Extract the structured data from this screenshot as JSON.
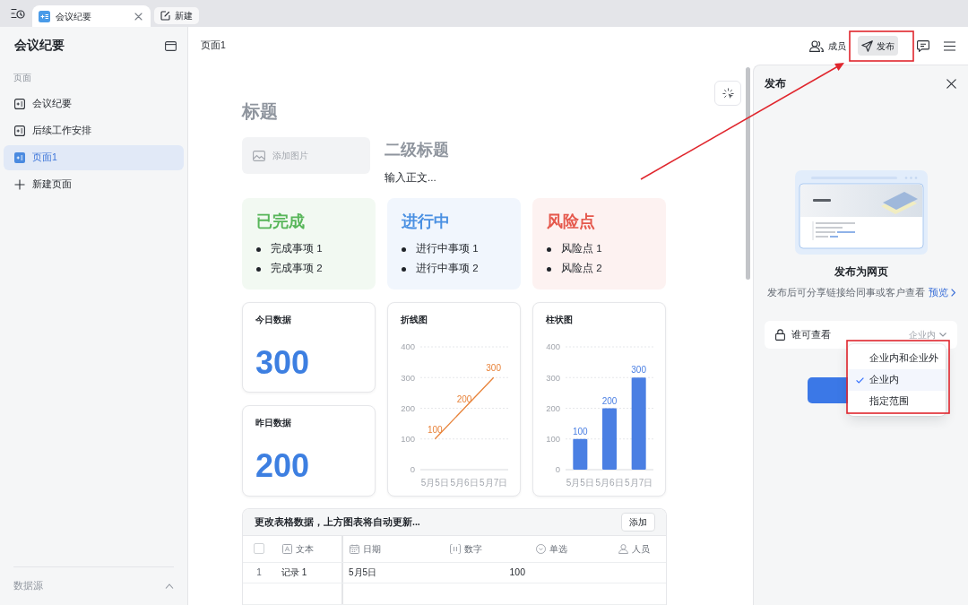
{
  "tab_bar": {
    "tabs": [
      {
        "label": "会议纪要",
        "selected": true
      }
    ],
    "new_button": "新建"
  },
  "sidebar": {
    "title": "会议纪要",
    "section_label": "页面",
    "pages": [
      {
        "label": "会议纪要",
        "selected": false
      },
      {
        "label": "后续工作安排",
        "selected": false
      },
      {
        "label": "页面1",
        "selected": true
      }
    ],
    "new_page": "新建页面",
    "footer": "数据源"
  },
  "header": {
    "page_title": "页面1",
    "members_button": "成员",
    "publish_button": {
      "label": "发布",
      "active": true
    }
  },
  "document": {
    "title": "标题",
    "image_placeholder": "添加图片",
    "subtitle": "二级标题",
    "body": "输入正文...",
    "status_cards": [
      {
        "title": "已完成",
        "color": "#58b65a",
        "items": [
          "完成事项 1",
          "完成事项 2"
        ]
      },
      {
        "title": "进行中",
        "color": "#4a90e2",
        "items": [
          "进行中事项 1",
          "进行中事项 2"
        ]
      },
      {
        "title": "风险点",
        "color": "#e5584c",
        "items": [
          "风险点 1",
          "风险点 2"
        ]
      }
    ],
    "metrics": [
      {
        "label": "今日数据",
        "value": "300"
      },
      {
        "label": "昨日数据",
        "value": "200"
      }
    ],
    "charts": [
      {
        "chart_data": {
          "type": "line",
          "title": "折线图",
          "categories": [
            "5月5日",
            "5月6日",
            "5月7日"
          ],
          "series": [
            {
              "color": "#e8833a",
              "values": [
                100,
                200,
                300
              ]
            }
          ],
          "ylim": [
            0,
            400
          ],
          "yticks": [
            0,
            100,
            200,
            300,
            400
          ],
          "grid": true,
          "data_labels": true
        }
      },
      {
        "chart_data": {
          "type": "bar",
          "title": "柱状图",
          "categories": [
            "5月5日",
            "5月6日",
            "5月7日"
          ],
          "series": [
            {
              "color": "#4a7fe3",
              "values": [
                100,
                200,
                300
              ]
            }
          ],
          "ylim": [
            0,
            400
          ],
          "yticks": [
            0,
            100,
            200,
            300,
            400
          ],
          "grid": true,
          "data_labels": true
        }
      }
    ],
    "table": {
      "caption": "更改表格数据，上方图表将自动更新...",
      "add_button": "添加",
      "select_all": {
        "checked": false
      },
      "columns": [
        {
          "label": "文本",
          "kind": "text"
        },
        {
          "label": "日期",
          "kind": "date"
        },
        {
          "label": "数字",
          "kind": "number"
        },
        {
          "label": "单选",
          "kind": "select"
        },
        {
          "label": "人员",
          "kind": "person"
        }
      ],
      "rows": [
        {
          "index": "1",
          "text": "记录 1",
          "date": "5月5日",
          "number": "100"
        }
      ]
    }
  },
  "publish_panel": {
    "title": "发布",
    "heading": "发布为网页",
    "description": "发布后可分享链接给同事或客户查看",
    "preview_link": "预览",
    "visibility": {
      "label": "谁可查看",
      "value": "企业内"
    },
    "options": [
      {
        "label": "企业内和企业外",
        "selected": false
      },
      {
        "label": "企业内",
        "selected": true
      },
      {
        "label": "指定范围",
        "selected": false
      }
    ]
  }
}
